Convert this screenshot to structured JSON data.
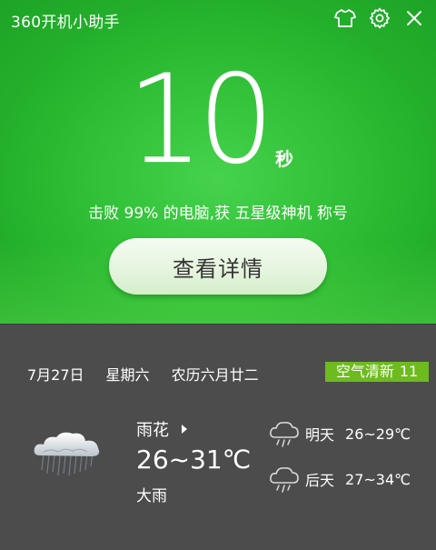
{
  "window": {
    "title": "360开机小助手"
  },
  "score": {
    "value": "10",
    "unit": "秒",
    "rank_text": "击败 99% 的电脑,获 五星级神机 称号"
  },
  "detail_button": {
    "label": "查看详情"
  },
  "date": {
    "day": "7月27日",
    "weekday": "星期六",
    "lunar": "农历六月廿二"
  },
  "air_quality": {
    "label": "空气清新",
    "value": "11"
  },
  "weather": {
    "city": "雨花",
    "temp_range": "26~31℃",
    "condition": "大雨",
    "icon": "rain-cloud-icon"
  },
  "forecast": [
    {
      "day": "明天",
      "temp": "26~29℃",
      "icon": "rain-cloud-outline-icon"
    },
    {
      "day": "后天",
      "temp": "27~34℃",
      "icon": "rain-cloud-outline-icon"
    }
  ],
  "colors": {
    "green_bg": "#2fbe35",
    "dark_bg": "#4c4c4c",
    "air_badge": "#6dbb1e"
  }
}
